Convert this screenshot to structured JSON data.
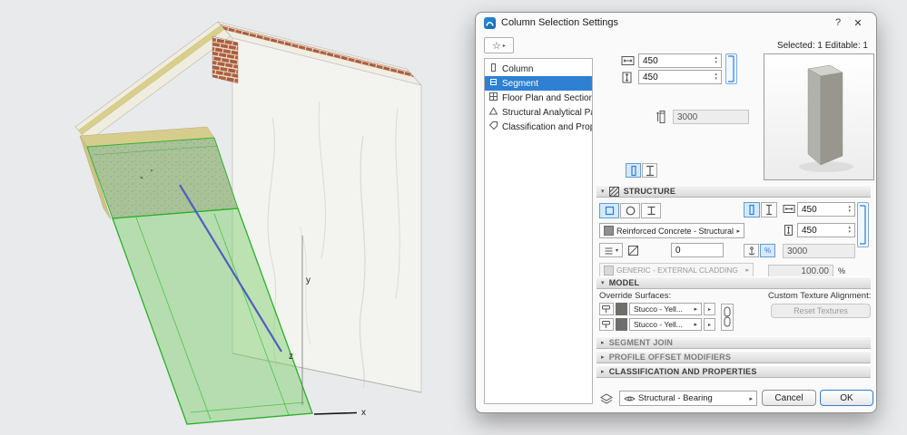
{
  "viewport": {
    "axes": {
      "x": "x",
      "y": "y",
      "z": "z"
    }
  },
  "icons": {
    "star": "☆",
    "help": "?",
    "close": "✕",
    "dropdown_arrow": "▸",
    "down_arrow": "▾",
    "up_arrow": "▴"
  },
  "dialog": {
    "title": "Column Selection Settings",
    "selection_status": "Selected: 1 Editable: 1",
    "tree": {
      "items": [
        {
          "label": "Column"
        },
        {
          "label": "Segment"
        },
        {
          "label": "Floor Plan and Section"
        },
        {
          "label": "Structural Analytical Paramet..."
        },
        {
          "label": "Classification and Properties"
        }
      ]
    },
    "geometry": {
      "width_value": "450",
      "height_value": "450",
      "length_value": "3000"
    },
    "structure": {
      "header": "STRUCTURE",
      "material": "Reinforced Concrete - Structural",
      "veneer_thickness": "0",
      "cladding": "GENERIC - EXTERNAL CLADDING",
      "core_width": "450",
      "core_height": "450",
      "segment_length": "3000",
      "ratio_value": "100.00",
      "percent_sign": "%"
    },
    "model": {
      "header": "MODEL",
      "override_surfaces_label": "Override Surfaces:",
      "surface_top": "Stucco - Yell...",
      "surface_side": "Stucco - Yell...",
      "custom_texture_label": "Custom Texture Alignment:",
      "reset_textures_label": "Reset Textures"
    },
    "collapsed_sections": [
      {
        "label": "SEGMENT JOIN"
      },
      {
        "label": "PROFILE OFFSET MODIFIERS"
      },
      {
        "label": "CLASSIFICATION AND PROPERTIES"
      }
    ],
    "footer": {
      "layer_value": "Structural - Bearing",
      "cancel_label": "Cancel",
      "ok_label": "OK"
    }
  }
}
